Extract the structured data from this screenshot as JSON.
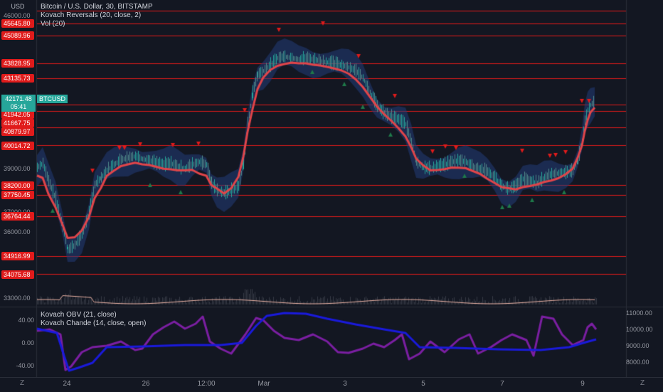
{
  "header": {
    "currency": "USD",
    "title": "Bitcoin / U.S. Dollar, 30, BITSTAMP",
    "indicator_1": "Kovach Reversals (20, close, 2)",
    "indicator_2": "Vol (20)"
  },
  "price_axis": {
    "top_label": "46000.00",
    "grey_labels": [
      "39000.00",
      "37000.00",
      "36000.00",
      "33000.00"
    ],
    "levels": [
      "45645.80",
      "45089.96",
      "43828.95",
      "43135.73",
      "41942.05",
      "41667.75",
      "40879.97",
      "40014.72",
      "38200.00",
      "37750.45",
      "36764.44",
      "34916.99",
      "34075.68"
    ]
  },
  "last_price": {
    "value": "42171.48",
    "countdown": "05:41",
    "symbol": "BTCUSD"
  },
  "lower_pane": {
    "indicator_1": "Kovach OBV (21, close)",
    "indicator_2": "Kovach Chande (14, close, open)",
    "left_axis": [
      "40.00",
      "0.00",
      "-40.00"
    ],
    "right_axis": [
      "11000.00",
      "10000.00",
      "9000.00",
      "8000.00"
    ]
  },
  "time_axis": [
    "24",
    "26",
    "12:00",
    "Mar",
    "3",
    "5",
    "7",
    "9"
  ],
  "controls": {
    "left": "Z",
    "right": "Z"
  },
  "colors": {
    "background": "#131722",
    "level_line": "#e01b1b",
    "price_line": "#e0454a",
    "band": "#1e3a6e",
    "up_marker": "#1f7a4a",
    "down_marker": "#e01b1b",
    "obv": "#1a1adb",
    "chande": "#7b1fa2",
    "last_price": "#26a69a"
  }
}
